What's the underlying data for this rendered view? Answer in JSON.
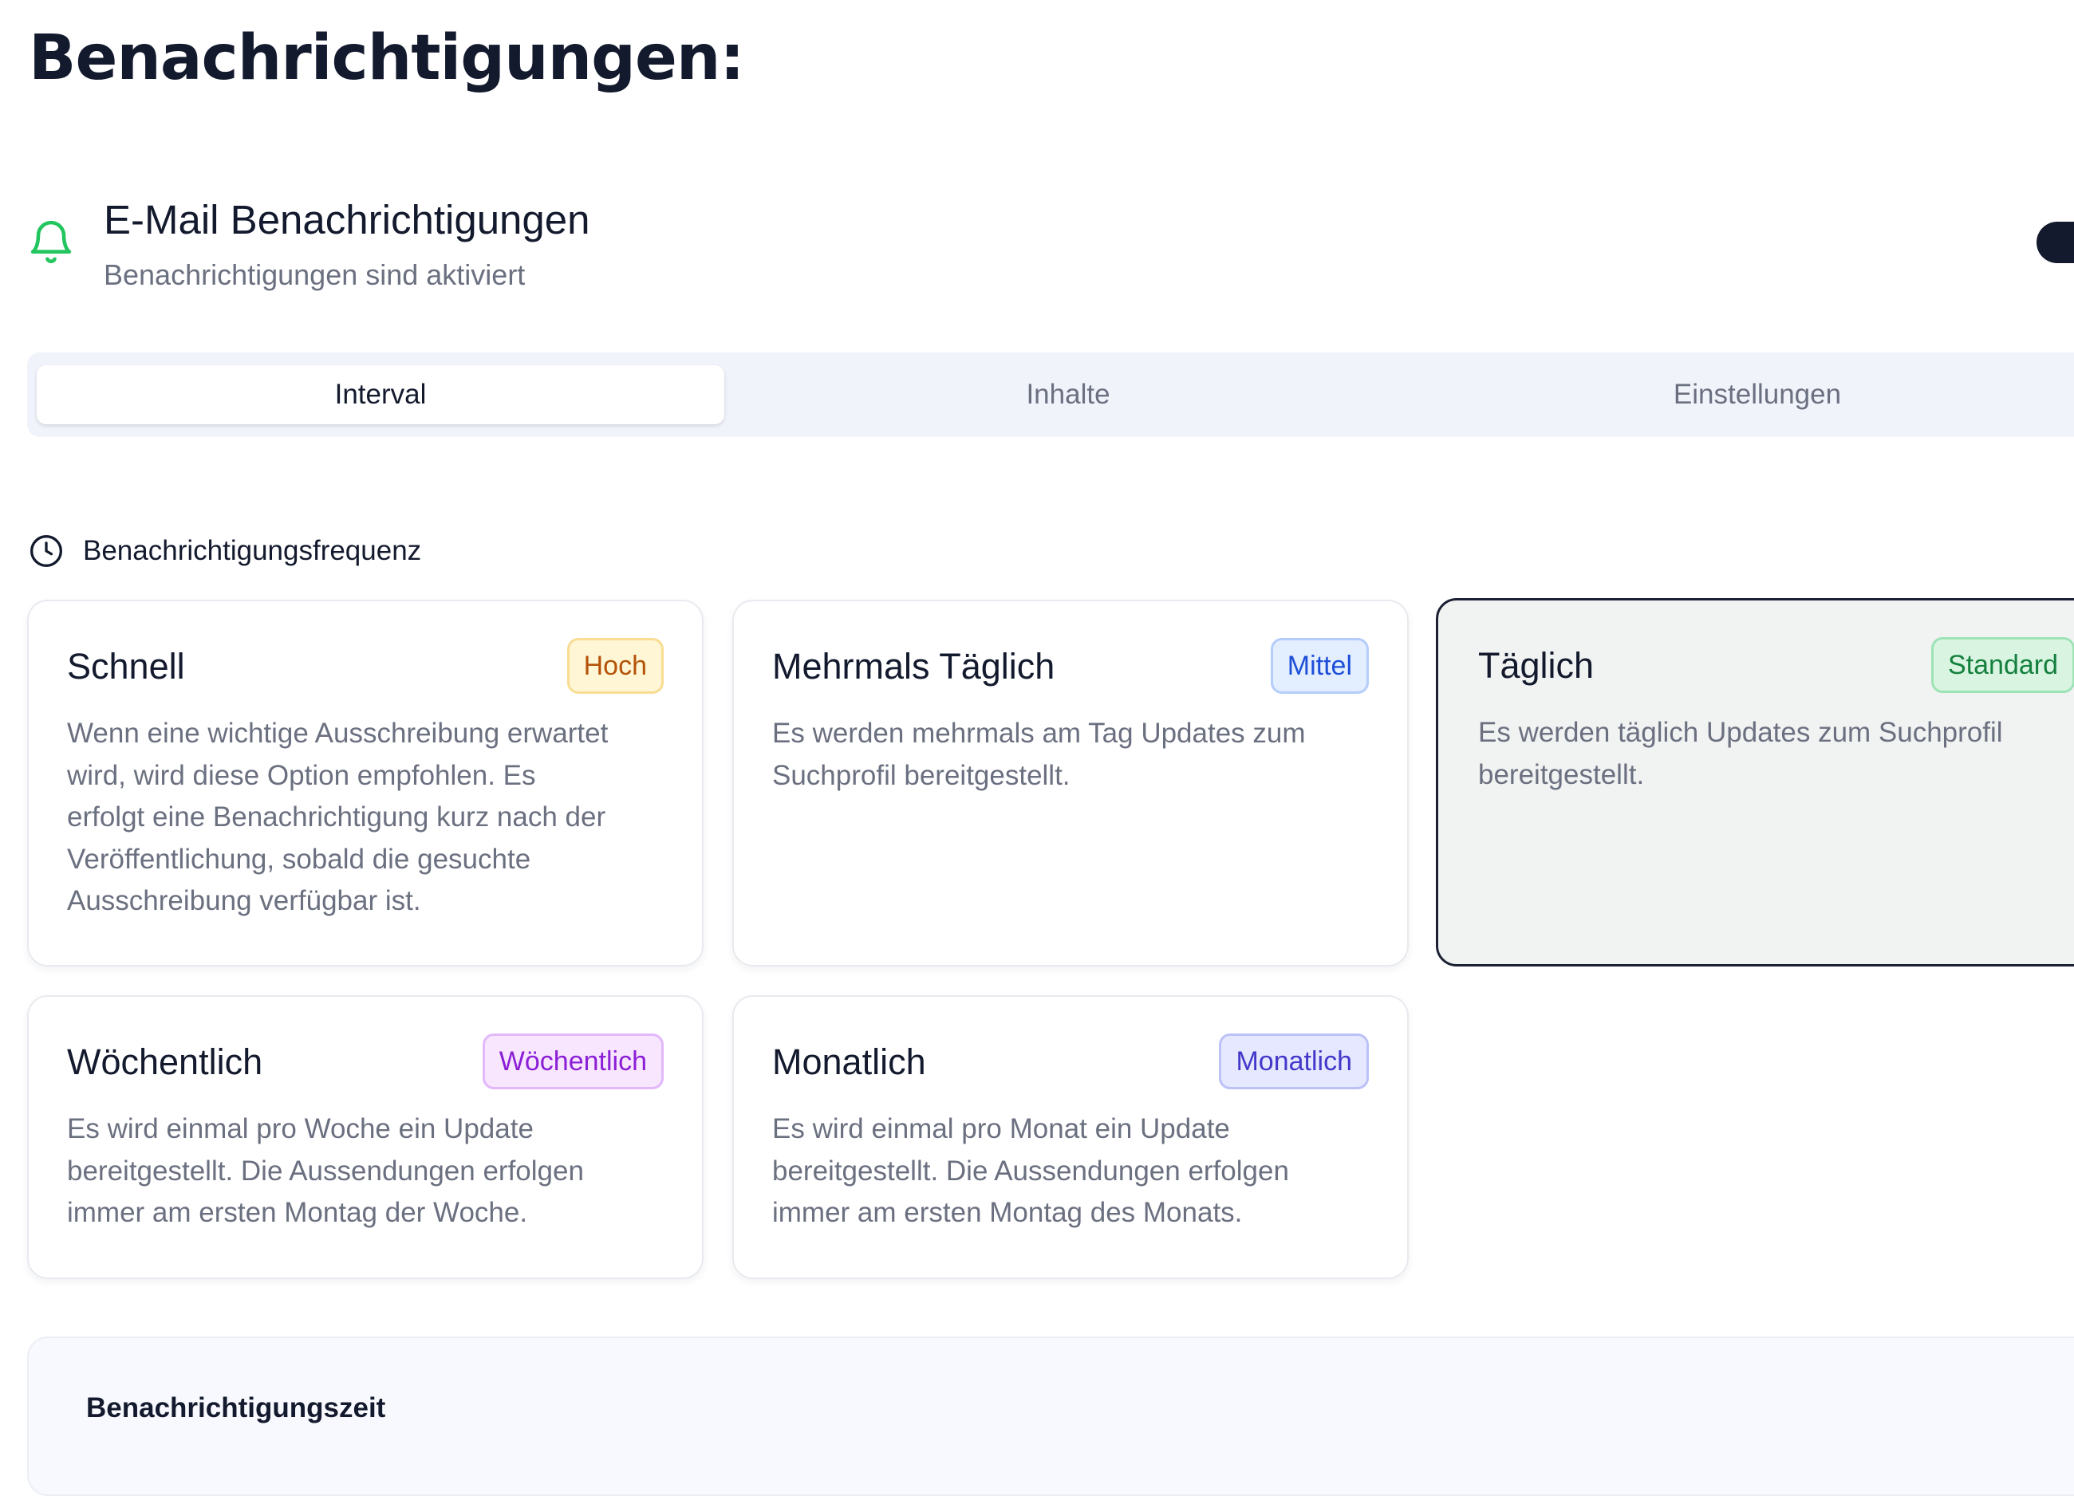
{
  "page": {
    "title": "Benachrichtigungen:"
  },
  "email_notifications": {
    "icon": "bell-icon",
    "title": "E-Mail Benachrichtigungen",
    "status": "Benachrichtigungen sind aktiviert",
    "enabled": true,
    "accent_color": "#22c55e"
  },
  "tabs": [
    {
      "label": "Interval",
      "active": true
    },
    {
      "label": "Inhalte",
      "active": false
    },
    {
      "label": "Einstellungen",
      "active": false
    }
  ],
  "frequency": {
    "icon": "clock-icon",
    "heading": "Benachrichtigungsfrequenz",
    "options": [
      {
        "title": "Schnell",
        "badge": "Hoch",
        "badge_color": "#b45309",
        "description_lines": [
          "Wenn eine wichtige Ausschreibung erwartet",
          "wird, wird diese Option empfohlen. Es",
          "erfolgt eine Benachrichtigung kurz nach der",
          "Veröffentlichung, sobald die gesuchte",
          "Ausschreibung verfügbar ist."
        ],
        "selected": false
      },
      {
        "title": "Mehrmals Täglich",
        "badge": "Mittel",
        "badge_color": "#1d4ed8",
        "description_lines": [
          "Es werden mehrmals am Tag Updates zum",
          "Suchprofil bereitgestellt."
        ],
        "selected": false
      },
      {
        "title": "Täglich",
        "badge": "Standard",
        "badge_color": "#15803d",
        "description_lines": [
          "Es werden täglich Updates zum Suchprofil",
          "bereitgestellt."
        ],
        "selected": true
      },
      {
        "title": "Wöchentlich",
        "badge": "Wöchentlich",
        "badge_color": "#8b1fd6",
        "description_lines": [
          "Es wird einmal pro Woche ein Update",
          "bereitgestellt. Die Aussendungen erfolgen",
          "immer am ersten Montag der Woche."
        ],
        "selected": false
      },
      {
        "title": "Monatlich",
        "badge": "Monatlich",
        "badge_color": "#4338ca",
        "description_lines": [
          "Es wird einmal pro Monat ein Update",
          "bereitgestellt. Die Aussendungen erfolgen",
          "immer am ersten Montag des Monats."
        ],
        "selected": false
      }
    ]
  },
  "notification_time": {
    "label": "Benachrichtigungszeit"
  }
}
